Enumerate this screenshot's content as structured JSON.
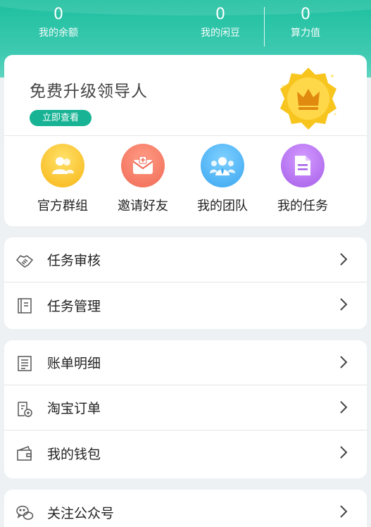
{
  "header": {
    "balance": {
      "value": "0",
      "label": "我的余额"
    },
    "beans": {
      "value": "0",
      "label": "我的闲豆"
    },
    "power": {
      "value": "0",
      "label": "算力值"
    }
  },
  "upgrade": {
    "title": "免费升级领导人",
    "button": "立即查看",
    "badge_icon": "crown-icon"
  },
  "quick_actions": [
    {
      "label": "官方群组",
      "icon": "group-icon",
      "color": "#f7b514"
    },
    {
      "label": "邀请好友",
      "icon": "invite-mail-icon",
      "color": "#f06a55"
    },
    {
      "label": "我的团队",
      "icon": "team-icon",
      "color": "#3aa6f0"
    },
    {
      "label": "我的任务",
      "icon": "task-doc-icon",
      "color": "#a55ee8"
    }
  ],
  "menu_groups": [
    [
      {
        "label": "任务审核",
        "icon": "handshake-icon"
      },
      {
        "label": "任务管理",
        "icon": "notebook-icon"
      }
    ],
    [
      {
        "label": "账单明细",
        "icon": "bill-list-icon"
      },
      {
        "label": "淘宝订单",
        "icon": "order-icon"
      },
      {
        "label": "我的钱包",
        "icon": "wallet-icon"
      }
    ],
    [
      {
        "label": "关注公众号",
        "icon": "wechat-icon"
      }
    ]
  ],
  "colors": {
    "accent": "#17b394",
    "header": "#1dbf9f"
  }
}
